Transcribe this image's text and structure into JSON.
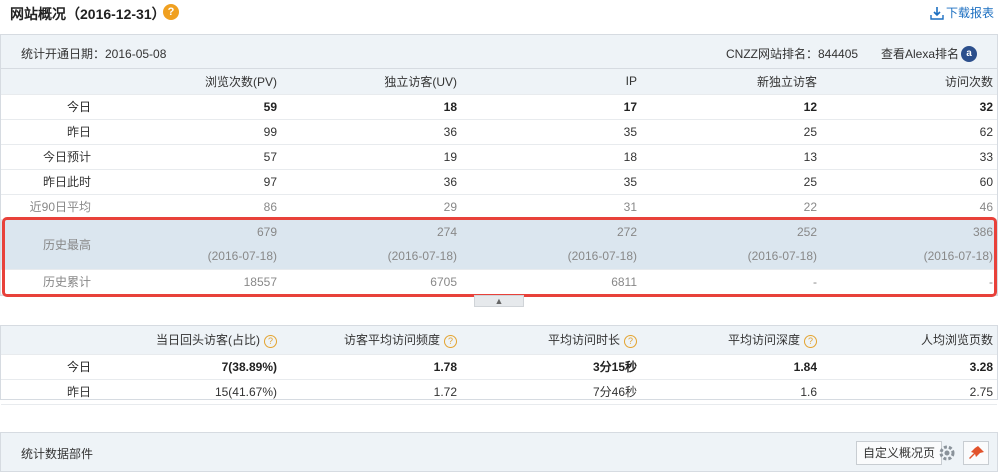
{
  "header": {
    "title": "网站概况（2016-12-31）",
    "help": "?",
    "download_label": "下载报表"
  },
  "overview": {
    "stat_date": "统计开通日期：2016-05-08",
    "cnzz_rank": "CNZZ网站排名：844405",
    "alexa_label": "查看Alexa排名",
    "alexa_icon_text": "a",
    "columns": [
      "浏览次数(PV)",
      "独立访客(UV)",
      "IP",
      "新独立访客",
      "访问次数"
    ],
    "rows": [
      {
        "label": "今日",
        "values": [
          "59",
          "18",
          "17",
          "12",
          "32"
        ]
      },
      {
        "label": "昨日",
        "values": [
          "99",
          "36",
          "35",
          "25",
          "62"
        ]
      },
      {
        "label": "今日预计",
        "values": [
          "57",
          "19",
          "18",
          "13",
          "33"
        ]
      },
      {
        "label": "昨日此时",
        "values": [
          "97",
          "36",
          "35",
          "25",
          "60"
        ]
      },
      {
        "label": "近90日平均",
        "values": [
          "86",
          "29",
          "31",
          "22",
          "46"
        ]
      }
    ],
    "history_max": {
      "label": "历史最高",
      "values": [
        "679",
        "274",
        "272",
        "252",
        "386"
      ],
      "dates": [
        "(2016-07-18)",
        "(2016-07-18)",
        "(2016-07-18)",
        "(2016-07-18)",
        "(2016-07-18)"
      ]
    },
    "history_total": {
      "label": "历史累计",
      "values": [
        "18557",
        "6705",
        "6811",
        "-",
        "-"
      ]
    }
  },
  "visits": {
    "columns": [
      "当日回头访客(占比)",
      "访客平均访问频度",
      "平均访问时长",
      "平均访问深度",
      "人均浏览页数"
    ],
    "help_flags": [
      true,
      true,
      true,
      true,
      false
    ],
    "rows": [
      {
        "label": "今日",
        "values": [
          "7(38.89%)",
          "1.78",
          "3分15秒",
          "1.84",
          "3.28"
        ]
      },
      {
        "label": "昨日",
        "values": [
          "15(41.67%)",
          "1.72",
          "7分46秒",
          "1.6",
          "2.75"
        ]
      }
    ]
  },
  "widgets": {
    "title": "统计数据部件",
    "custom_button": "自定义概况页"
  },
  "colors": {
    "highlight": "#e8413a",
    "link": "#1c6fc1",
    "help": "#f0a020"
  }
}
